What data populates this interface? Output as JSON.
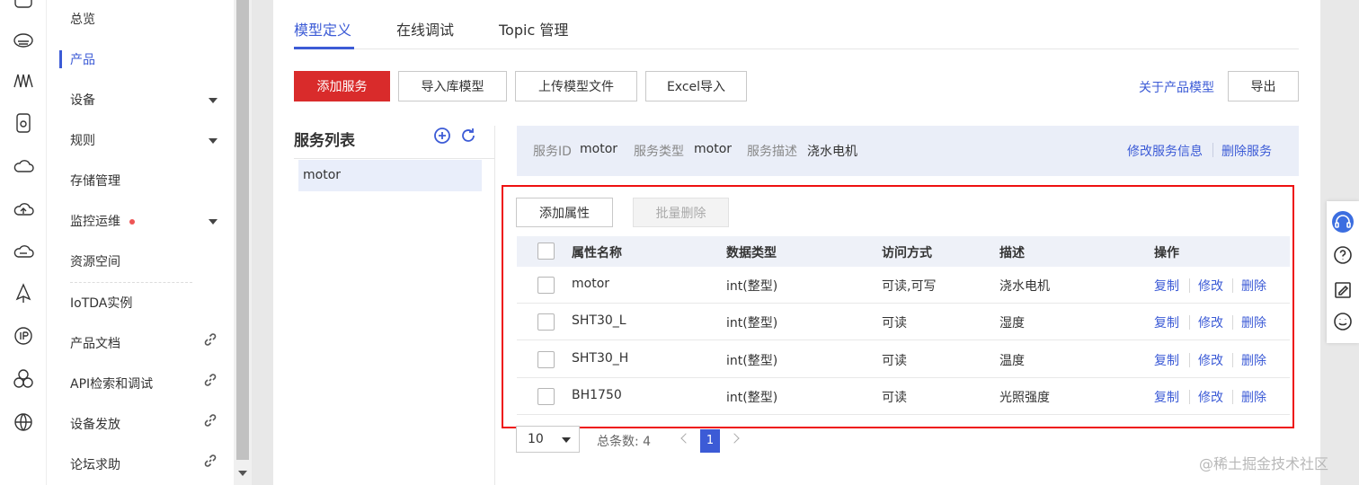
{
  "menu": {
    "items": [
      {
        "label": "总览"
      },
      {
        "label": "产品"
      },
      {
        "label": "设备"
      },
      {
        "label": "规则"
      },
      {
        "label": "存储管理"
      },
      {
        "label": "监控运维"
      },
      {
        "label": "资源空间"
      },
      {
        "label": "IoTDA实例"
      },
      {
        "label": "产品文档"
      },
      {
        "label": "API检索和调试"
      },
      {
        "label": "设备发放"
      },
      {
        "label": "论坛求助"
      }
    ]
  },
  "tabs": [
    {
      "label": "模型定义"
    },
    {
      "label": "在线调试"
    },
    {
      "label": "Topic 管理"
    }
  ],
  "toolbar": {
    "add_service": "添加服务",
    "import_library": "导入库模型",
    "upload_model": "上传模型文件",
    "excel_import": "Excel导入",
    "about_model": "关于产品模型",
    "export": "导出"
  },
  "service_list": {
    "title": "服务列表",
    "items": [
      {
        "label": "motor"
      }
    ]
  },
  "service_info": {
    "id_label": "服务ID",
    "id_value": "motor",
    "type_label": "服务类型",
    "type_value": "motor",
    "desc_label": "服务描述",
    "desc_value": "浇水电机",
    "edit_link": "修改服务信息",
    "delete_link": "删除服务"
  },
  "attributes": {
    "add_label": "添加属性",
    "batch_delete_label": "批量删除",
    "columns": [
      "属性名称",
      "数据类型",
      "访问方式",
      "描述",
      "操作"
    ],
    "rows": [
      {
        "name": "motor",
        "type": "int(整型)",
        "access": "可读,可写",
        "desc": "浇水电机"
      },
      {
        "name": "SHT30_L",
        "type": "int(整型)",
        "access": "可读",
        "desc": "湿度"
      },
      {
        "name": "SHT30_H",
        "type": "int(整型)",
        "access": "可读",
        "desc": "温度"
      },
      {
        "name": "BH1750",
        "type": "int(整型)",
        "access": "可读",
        "desc": "光照强度"
      }
    ],
    "ops": {
      "copy": "复制",
      "edit": "修改",
      "delete": "删除"
    }
  },
  "pagination": {
    "page_size": "10",
    "total_label": "总条数: 4",
    "current_page": "1"
  },
  "watermark": "@稀土掘金技术社区"
}
